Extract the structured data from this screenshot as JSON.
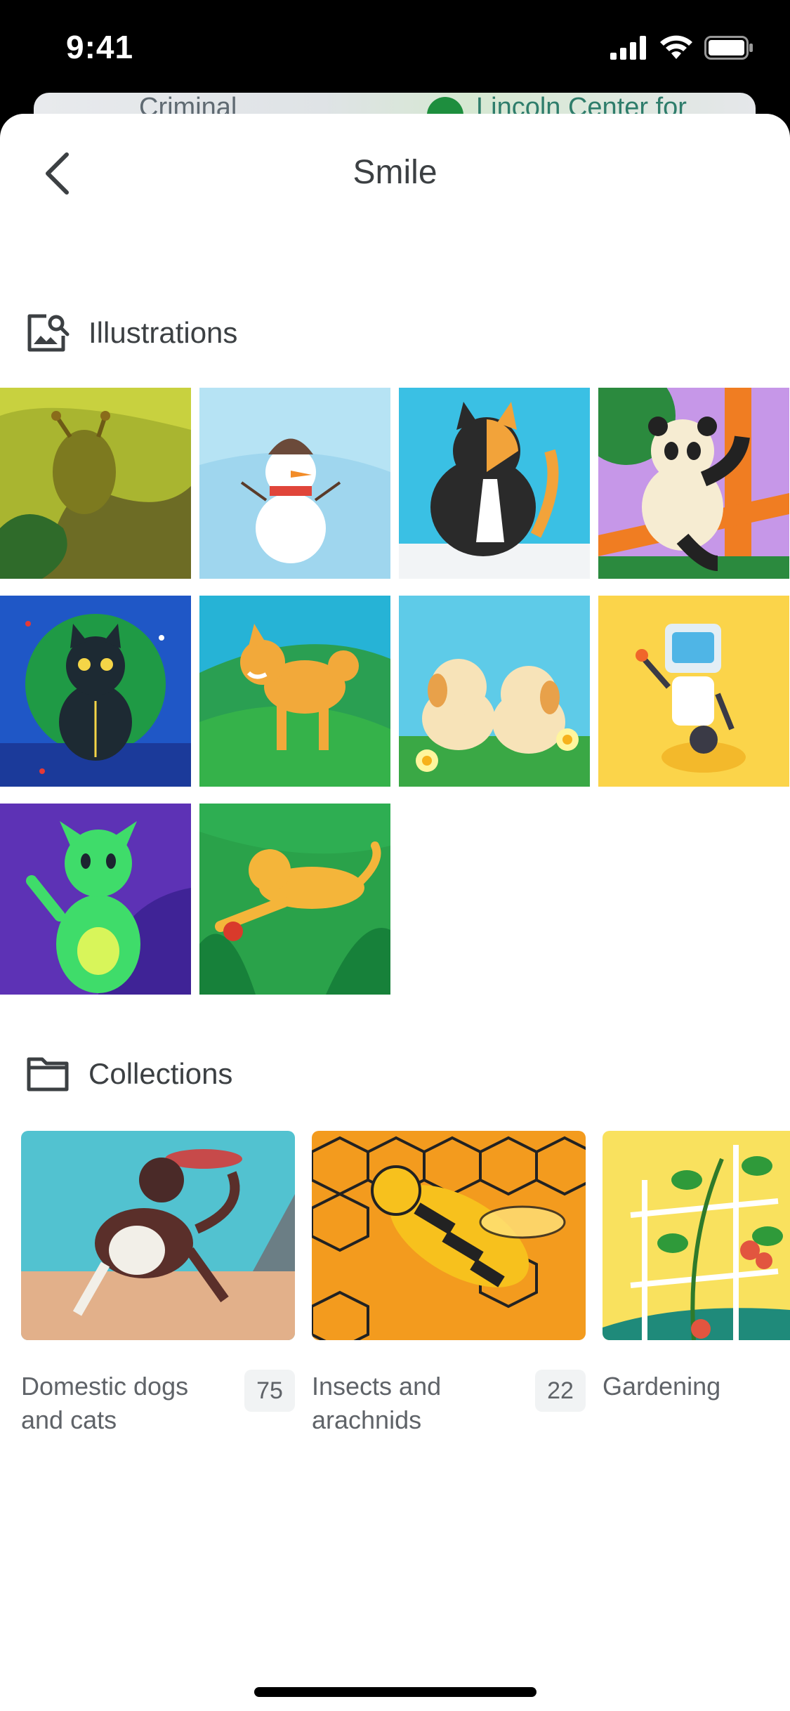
{
  "status_bar": {
    "time": "9:41"
  },
  "map_peek": {
    "left_label": "Criminal",
    "right_label": "Lincoln Center for"
  },
  "header": {
    "title": "Smile"
  },
  "illustrations": {
    "heading": "Illustrations",
    "items": [
      {
        "name": "snail"
      },
      {
        "name": "snowman"
      },
      {
        "name": "calico-cat"
      },
      {
        "name": "panda"
      },
      {
        "name": "black-cat"
      },
      {
        "name": "shiba-dog"
      },
      {
        "name": "puppies"
      },
      {
        "name": "robot"
      },
      {
        "name": "alien"
      },
      {
        "name": "golden-retriever"
      }
    ]
  },
  "collections": {
    "heading": "Collections",
    "items": [
      {
        "label": "Domestic dogs and cats",
        "count": "75"
      },
      {
        "label": "Insects and arachnids",
        "count": "22"
      },
      {
        "label": "Gardening",
        "count": ""
      }
    ]
  }
}
